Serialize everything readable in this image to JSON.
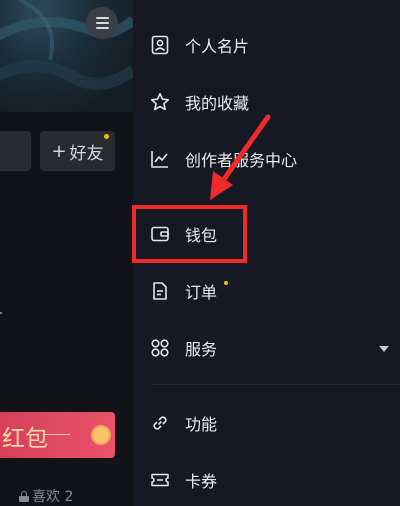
{
  "background": {
    "friend_button": {
      "plus": "+",
      "label": "好友"
    },
    "red_packet": {
      "text": "红包"
    },
    "likes": {
      "label": "喜欢 2"
    }
  },
  "drawer": {
    "items": [
      {
        "label": "个人名片",
        "icon": "profile-card-icon"
      },
      {
        "label": "我的收藏",
        "icon": "star-icon"
      },
      {
        "label": "创作者服务中心",
        "icon": "chart-line-icon"
      },
      {
        "label": "钱包",
        "icon": "wallet-icon"
      },
      {
        "label": "订单",
        "icon": "order-document-icon"
      },
      {
        "label": "服务",
        "icon": "grid-services-icon"
      },
      {
        "label": "功能",
        "icon": "link-icon"
      },
      {
        "label": "卡券",
        "icon": "ticket-icon"
      }
    ]
  },
  "colors": {
    "drawer_bg": "#161823",
    "highlight": "#ef2a2a",
    "badge": "#f2c200"
  }
}
